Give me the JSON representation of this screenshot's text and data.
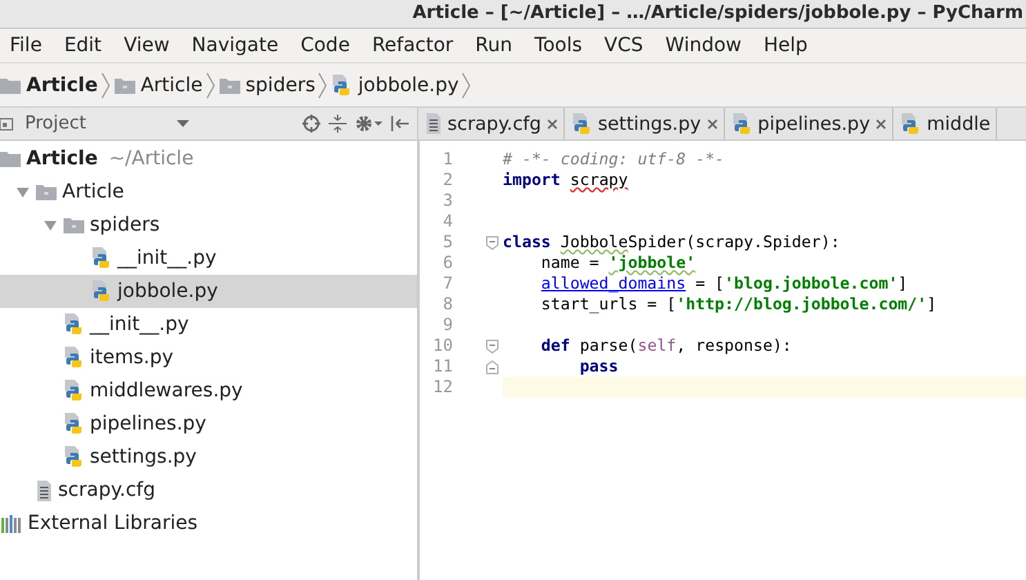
{
  "window": {
    "title": "Article – [~/Article] – …/Article/spiders/jobbole.py – PyCharm"
  },
  "menu": [
    "File",
    "Edit",
    "View",
    "Navigate",
    "Code",
    "Refactor",
    "Run",
    "Tools",
    "VCS",
    "Window",
    "Help"
  ],
  "breadcrumbs": [
    {
      "label": "Article",
      "kind": "project"
    },
    {
      "label": "Article",
      "kind": "folder"
    },
    {
      "label": "spiders",
      "kind": "folder"
    },
    {
      "label": "jobbole.py",
      "kind": "python"
    }
  ],
  "project_panel": {
    "title": "Project"
  },
  "tree": [
    {
      "label": "Article",
      "hint": "~/Article",
      "kind": "project",
      "selected": false,
      "children": [
        {
          "label": "Article",
          "kind": "folder",
          "expanded": true,
          "selected": false,
          "children": [
            {
              "label": "spiders",
              "kind": "folder",
              "expanded": true,
              "selected": false,
              "children": [
                {
                  "label": "__init__.py",
                  "kind": "python",
                  "selected": false
                },
                {
                  "label": "jobbole.py",
                  "kind": "python",
                  "selected": true
                }
              ]
            },
            {
              "label": "__init__.py",
              "kind": "python",
              "selected": false
            },
            {
              "label": "items.py",
              "kind": "python",
              "selected": false
            },
            {
              "label": "middlewares.py",
              "kind": "python",
              "selected": false
            },
            {
              "label": "pipelines.py",
              "kind": "python",
              "selected": false
            },
            {
              "label": "settings.py",
              "kind": "python",
              "selected": false
            }
          ]
        },
        {
          "label": "scrapy.cfg",
          "kind": "text",
          "selected": false
        }
      ]
    },
    {
      "label": "External Libraries",
      "kind": "libraries",
      "selected": false
    }
  ],
  "tabs": [
    {
      "label": "scrapy.cfg",
      "kind": "text"
    },
    {
      "label": "settings.py",
      "kind": "python"
    },
    {
      "label": "pipelines.py",
      "kind": "python"
    },
    {
      "label": "middle",
      "kind": "python"
    }
  ],
  "code": [
    {
      "number": "1",
      "current": false,
      "tokens": [
        {
          "text": "# -*- coding: utf-8 -*-",
          "kind": "comment"
        }
      ]
    },
    {
      "number": "2",
      "current": false,
      "tokens": [
        {
          "text": "import",
          "kind": "keyword"
        },
        {
          "text": "scrapy",
          "kind": "plain",
          "unresolved": true
        }
      ]
    },
    {
      "number": "3",
      "current": false
    },
    {
      "number": "4",
      "current": false
    },
    {
      "number": "5",
      "current": false,
      "fold_start": true,
      "tokens": [
        {
          "text": "class",
          "kind": "keyword"
        },
        {
          "text": "Jobbole",
          "kind": "plain",
          "misspelled": true
        },
        {
          "text": "Spider(scrapy.Spider):",
          "kind": "plain"
        }
      ],
      "body": [
        {
          "number": "6",
          "current": false,
          "tokens": [
            {
              "text": "name = ",
              "kind": "plain"
            },
            {
              "text": "'jobbole'",
              "kind": "string",
              "misspelled": true
            }
          ]
        },
        {
          "number": "7",
          "current": false,
          "tokens": [
            {
              "text": "allowed_domains",
              "kind": "link"
            },
            {
              "text": " = [",
              "kind": "plain"
            },
            {
              "text": "'blog.jobbole.com'",
              "kind": "string"
            },
            {
              "text": "]",
              "kind": "plain"
            }
          ]
        },
        {
          "number": "8",
          "current": false,
          "tokens": [
            {
              "text": "start_urls = [",
              "kind": "plain"
            },
            {
              "text": "'http://blog.jobbole.com/'",
              "kind": "string"
            },
            {
              "text": "]",
              "kind": "plain"
            }
          ]
        },
        {
          "number": "9",
          "current": false
        },
        {
          "number": "10",
          "current": false,
          "fold_start": true,
          "tokens": [
            {
              "text": "def",
              "kind": "keyword"
            },
            {
              "text": "parse(",
              "kind": "plain"
            },
            {
              "text": "self",
              "kind": "self"
            },
            {
              "text": ", response):",
              "kind": "plain"
            }
          ],
          "body": [
            {
              "number": "11",
              "current": false,
              "fold_end": true,
              "tokens": [
                {
                  "text": "pass",
                  "kind": "keyword"
                }
              ]
            }
          ]
        }
      ]
    },
    {
      "number": "12",
      "current": true
    }
  ]
}
